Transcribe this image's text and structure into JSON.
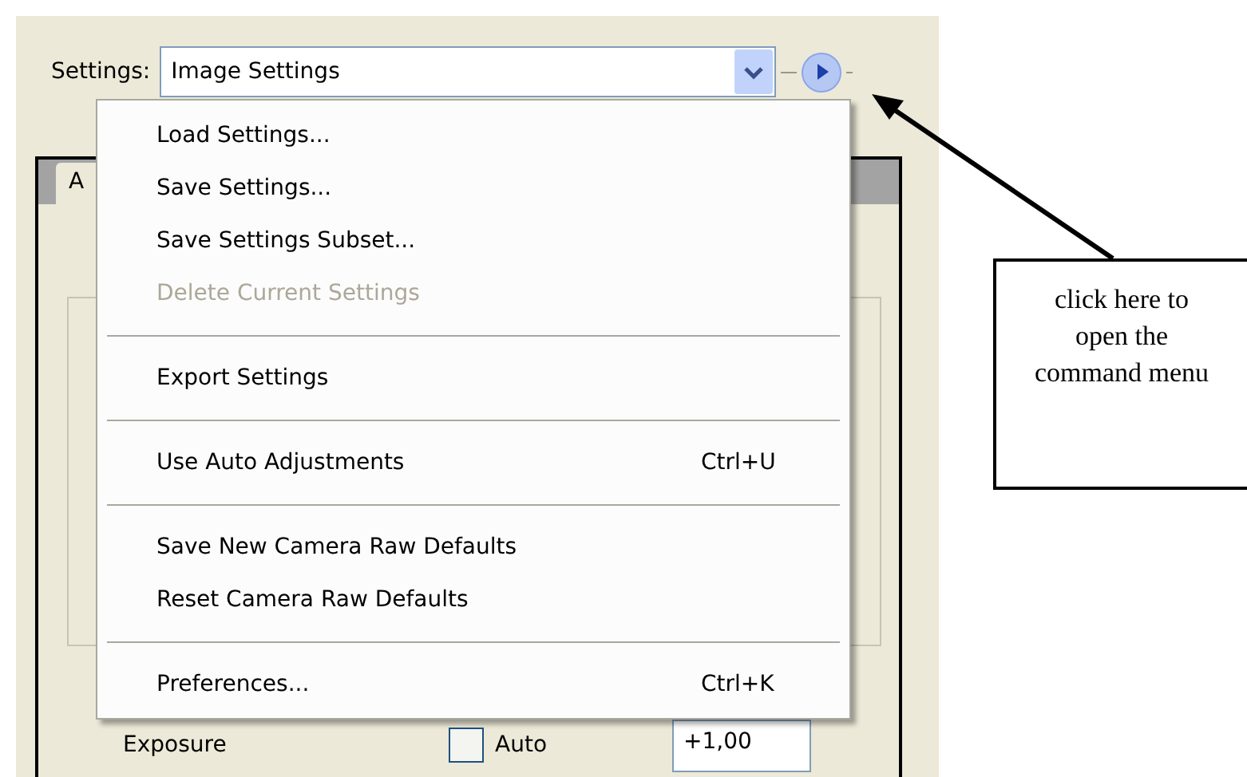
{
  "settings": {
    "label": "Settings:",
    "value": "Image Settings"
  },
  "tabs": [
    {
      "label": "A",
      "selected": true
    }
  ],
  "menu": {
    "groups": [
      [
        {
          "label": "Load Settings...",
          "disabled": false
        },
        {
          "label": "Save Settings...",
          "disabled": false
        },
        {
          "label": "Save Settings Subset...",
          "disabled": false
        },
        {
          "label": "Delete Current Settings",
          "disabled": true
        }
      ],
      [
        {
          "label": "Export Settings",
          "disabled": false
        }
      ],
      [
        {
          "label": "Use Auto Adjustments",
          "shortcut": "Ctrl+U",
          "disabled": false
        }
      ],
      [
        {
          "label": "Save New Camera Raw Defaults",
          "disabled": false
        },
        {
          "label": "Reset Camera Raw Defaults",
          "disabled": false
        }
      ],
      [
        {
          "label": "Preferences...",
          "shortcut": "Ctrl+K",
          "disabled": false
        }
      ]
    ]
  },
  "exposure": {
    "label": "Exposure",
    "auto_label": "Auto",
    "checked": false,
    "value": "+1,00"
  },
  "callout": {
    "text": "click here to open the command menu"
  }
}
